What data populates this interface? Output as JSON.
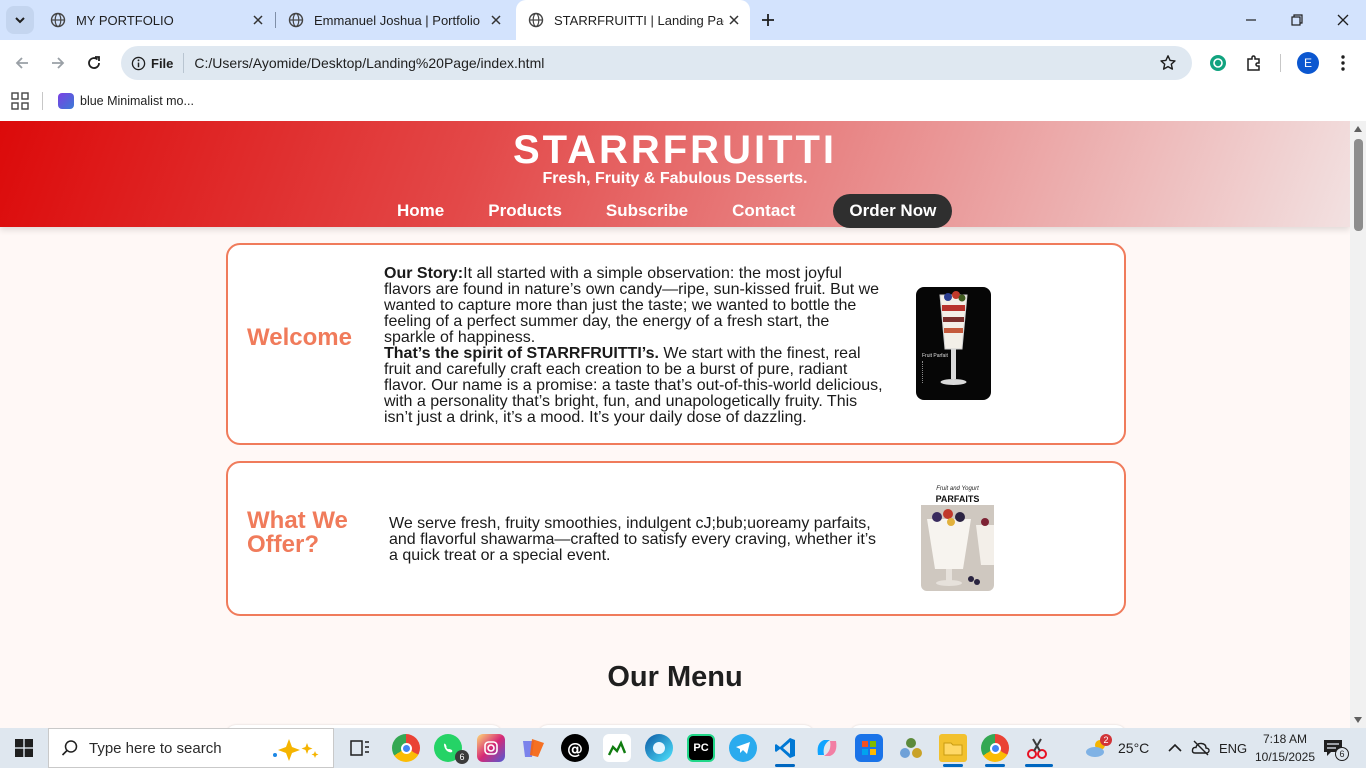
{
  "browser": {
    "tabs": [
      {
        "title": "MY PORTFOLIO",
        "active": false
      },
      {
        "title": "Emmanuel Joshua | Portfolio",
        "active": false
      },
      {
        "title": "STARRFRUITTI | Landing Page",
        "active": true
      }
    ],
    "address": {
      "scheme_label": "File",
      "url": "C:/Users/Ayomide/Desktop/Landing%20Page/index.html"
    },
    "profile_initial": "E",
    "bookmarks": [
      {
        "label": "blue Minimalist mo..."
      }
    ]
  },
  "site": {
    "brand": "STARRFRUITTI",
    "tagline": "Fresh, Fruity & Fabulous Desserts.",
    "nav": [
      "Home",
      "Products",
      "Subscribe",
      "Contact"
    ],
    "cta": "Order Now",
    "welcome": {
      "title": "Welcome",
      "story_label": "Our Story:",
      "story_lines": [
        "It all started with a simple observation: the most joyful",
        "flavors are found in nature’s own candy—ripe, sun-kissed fruit. But we",
        "wanted to capture more than just the taste; we wanted to bottle the",
        "feeling of a perfect summer day, the energy of a fresh start, the",
        "sparkle of happiness."
      ],
      "spirit_label": "That’s the spirit of STARRFRUITTI’s.",
      "spirit_lines": [
        " We start with the finest, real",
        "fruit and carefully craft each creation to be a burst of pure, radiant",
        "flavor. Our name is a promise: a taste that’s out-of-this-world delicious,",
        "with a personality that’s bright, fun, and unapologetically fruity. This",
        "isn’t just a drink, it’s a mood. It’s your daily dose of dazzling."
      ],
      "image_caption": "Fruit Parfait"
    },
    "offer": {
      "title_line1": "What We",
      "title_line2": "Offer?",
      "lines": [
        "We serve fresh, fruity smoothies, indulgent cJ;bub;uoreamy parfaits,",
        "and flavorful shawarma—crafted to satisfy every craving, whether it’s",
        "a quick treat or a special event."
      ],
      "image_caption_line1": "Fruit and Yogurt",
      "image_caption_line2": "PARFAITS"
    },
    "menu_heading": "Our Menu"
  },
  "taskbar": {
    "search_placeholder": "Type here to search",
    "weather": "25°C",
    "language": "ENG",
    "time": "7:18 AM",
    "date": "10/15/2025",
    "notifications": "6",
    "whatsapp_badge": "6",
    "weather_badge": "2"
  },
  "colors": {
    "accent": "#f07b5b",
    "header_start": "#dc0a0a",
    "header_end": "#f2e1e1",
    "cta_bg": "#2f2f2f",
    "page_bg": "#fff8f6"
  }
}
